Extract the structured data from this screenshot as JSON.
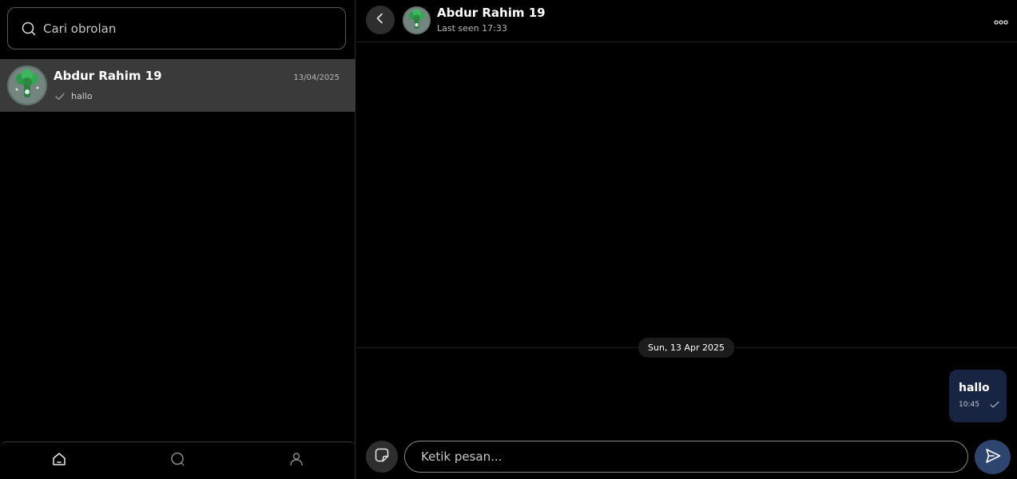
{
  "sidebar": {
    "search": {
      "placeholder": "Cari obrolan",
      "icon": "search-icon"
    },
    "chats": [
      {
        "name": "Abdur Rahim 19",
        "date": "13/04/2025",
        "preview": "hallo",
        "status_icon": "check-icon"
      }
    ],
    "nav": [
      {
        "id": "home",
        "icon": "home-icon"
      },
      {
        "id": "chats",
        "icon": "chat-bubble-icon"
      },
      {
        "id": "profile",
        "icon": "user-icon"
      }
    ]
  },
  "conversation": {
    "contact_name": "Abdur Rahim 19",
    "last_seen": "Last seen 17:33",
    "date_separator": "Sun, 13 Apr 2025",
    "messages": [
      {
        "text": "hallo",
        "time": "10:45",
        "direction": "outgoing",
        "status_icon": "check-icon"
      }
    ],
    "composer": {
      "placeholder": "Ketik pesan..."
    }
  },
  "colors": {
    "background": "#000000",
    "selected_chat": "#3a3a3a",
    "outgoing_bubble": "#172543",
    "send_button": "#2e4570",
    "icon_button": "#2e2e2e"
  }
}
